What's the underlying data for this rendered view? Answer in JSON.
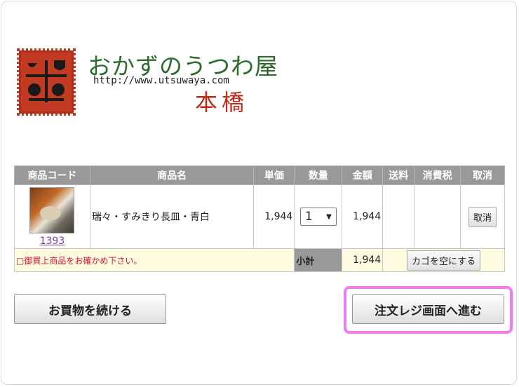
{
  "logo": {
    "title": "おかずのうつわ屋",
    "url": "http://www.utsuwaya.com",
    "subtitle": "本橋",
    "brand_red": "#c33a23",
    "brand_green": "#2c6b2a"
  },
  "table": {
    "headers": [
      "商品コード",
      "商品名",
      "単価",
      "数量",
      "金額",
      "送料",
      "消費税",
      "取消"
    ],
    "item": {
      "code": "1393",
      "name": "瑞々・すみきり長皿・青白",
      "unit_price": "1,944",
      "quantity": "1",
      "amount": "1,944",
      "shipping": "",
      "tax": "",
      "cancel_label": "取消"
    },
    "note": "□御買上商品をお確かめ下さい。",
    "subtotal_label": "小計",
    "subtotal_value": "1,944",
    "empty_cart_label": "カゴを空にする"
  },
  "buttons": {
    "continue_shopping": "お買物を続ける",
    "checkout": "注文レジ画面へ進む"
  },
  "colors": {
    "header_bg": "#999999",
    "note_text": "#d0142b",
    "highlight": "#f07df0"
  }
}
